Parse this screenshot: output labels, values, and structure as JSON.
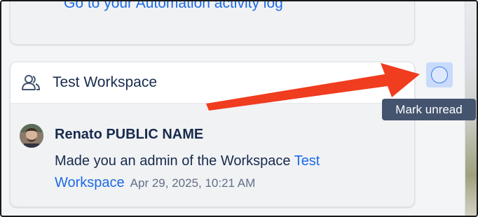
{
  "top_card": {
    "activity_link": "Go to your Automation activity log"
  },
  "notification": {
    "workspace_icon": "people-icon",
    "workspace_title": "Test Workspace",
    "actor_name": "Renato PUBLIC NAME",
    "message_prefix": "Made you an admin of the Workspace",
    "workspace_link_part1": "Test",
    "workspace_link_part2": "Workspace",
    "timestamp": "Apr 29, 2025, 10:21 AM"
  },
  "mark_unread": {
    "icon": "circle-icon",
    "tooltip": "Mark unread"
  },
  "annotation": {
    "arrow_color": "#f03c1f"
  },
  "colors": {
    "link": "#1d6ae5",
    "text": "#172b4d",
    "muted": "#626f86",
    "tooltip_bg": "#44546f",
    "button_bg": "#c9dbfb"
  }
}
